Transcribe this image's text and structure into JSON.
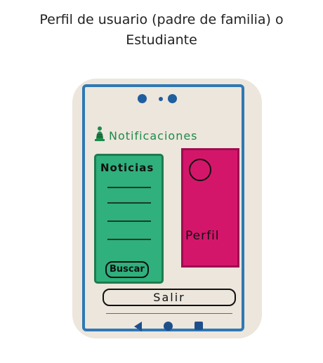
{
  "caption": {
    "line1": "Perfil de usuario (padre de familia)  o",
    "line2": "Estudiante"
  },
  "app": {
    "notifications_label": "Notificaciones",
    "news_title": "Noticias",
    "search_label": "Buscar",
    "profile_label": "Perfil",
    "logout_label": "Salir"
  },
  "colors": {
    "frame": "#2f78b5",
    "news_panel": "#2fb07c",
    "profile_panel": "#d4166b",
    "notifications_text": "#1f8a4a"
  },
  "icons": [
    "bell-icon",
    "avatar-circle-icon",
    "nav-back-icon",
    "nav-home-icon",
    "nav-recent-icon"
  ]
}
